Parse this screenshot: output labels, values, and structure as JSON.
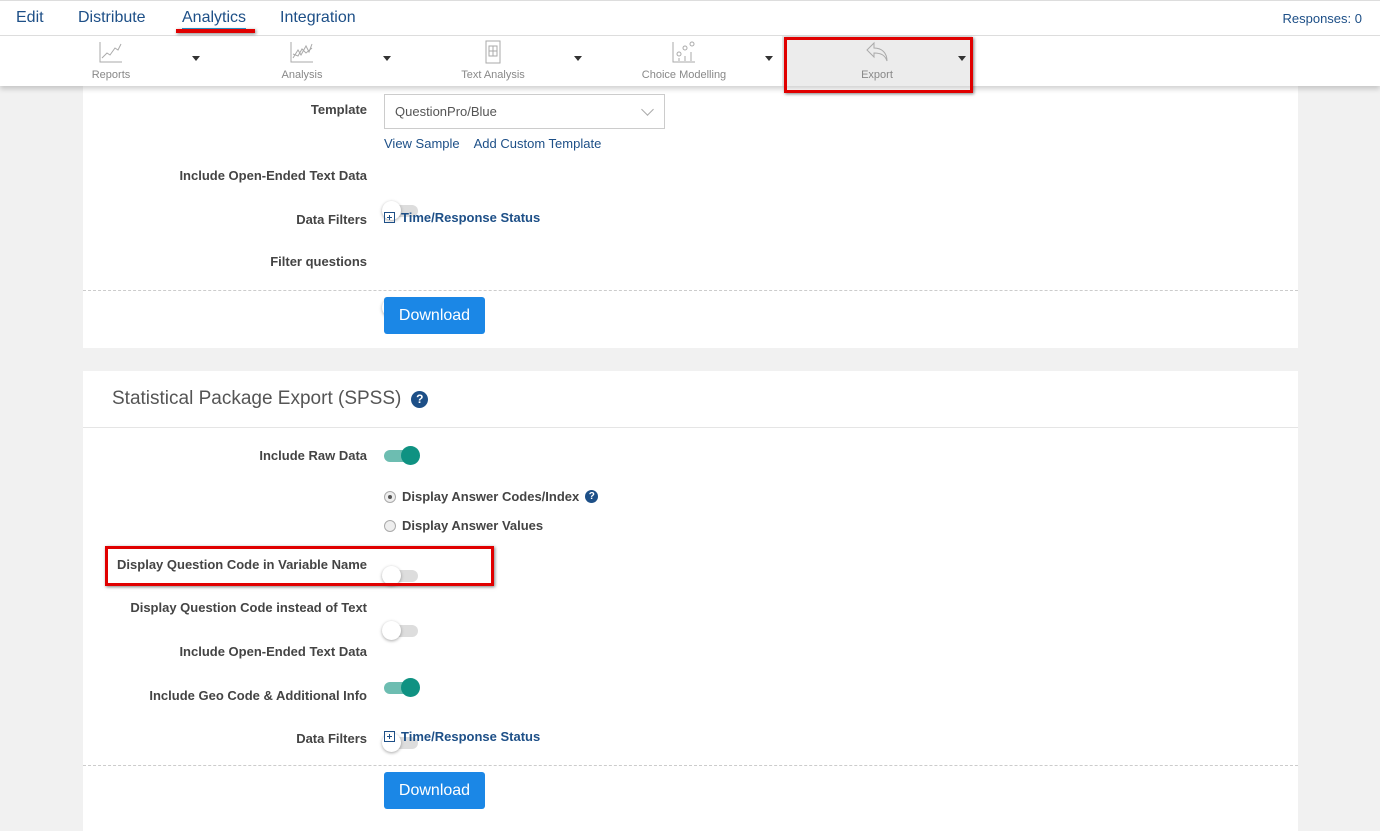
{
  "topnav": {
    "tabs": [
      "Edit",
      "Distribute",
      "Analytics",
      "Integration"
    ],
    "active": "Analytics",
    "responses": "Responses: 0"
  },
  "toolbar": {
    "items": [
      {
        "label": "Reports",
        "icon": "line-chart-icon"
      },
      {
        "label": "Analysis",
        "icon": "multi-line-chart-icon"
      },
      {
        "label": "Text Analysis",
        "icon": "document-icon"
      },
      {
        "label": "Choice Modelling",
        "icon": "scatter-chart-icon"
      },
      {
        "label": "Export",
        "icon": "reply-arrow-icon"
      }
    ],
    "active": "Export"
  },
  "card1": {
    "template_label": "Template",
    "template_value": "QuestionPro/Blue",
    "view_sample": "View Sample",
    "add_custom_template": "Add Custom Template",
    "open_ended_label": "Include Open-Ended Text Data",
    "open_ended_on": false,
    "data_filters_label": "Data Filters",
    "data_filters_link": "Time/Response Status",
    "filter_questions_label": "Filter questions",
    "filter_questions_on": false,
    "download": "Download"
  },
  "card2": {
    "title": "Statistical Package Export (SPSS)",
    "raw_data_label": "Include Raw Data",
    "raw_data_on": true,
    "radio_codes": "Display Answer Codes/Index",
    "radio_values": "Display Answer Values",
    "radio_selected": "codes",
    "qcode_varname_label": "Display Question Code in Variable Name",
    "qcode_varname_on": false,
    "qcode_instead_label": "Display Question Code instead of Text",
    "qcode_instead_on": false,
    "open_ended_label": "Include Open-Ended Text Data",
    "open_ended_on": true,
    "geo_label": "Include Geo Code & Additional Info",
    "geo_on": false,
    "data_filters_label": "Data Filters",
    "data_filters_link": "Time/Response Status",
    "download": "Download"
  },
  "help_glyph": "?",
  "colors": {
    "accent": "#1b87e6",
    "toggle_on": "#0f9282",
    "highlight": "#e00000",
    "link": "#1d4f87"
  }
}
